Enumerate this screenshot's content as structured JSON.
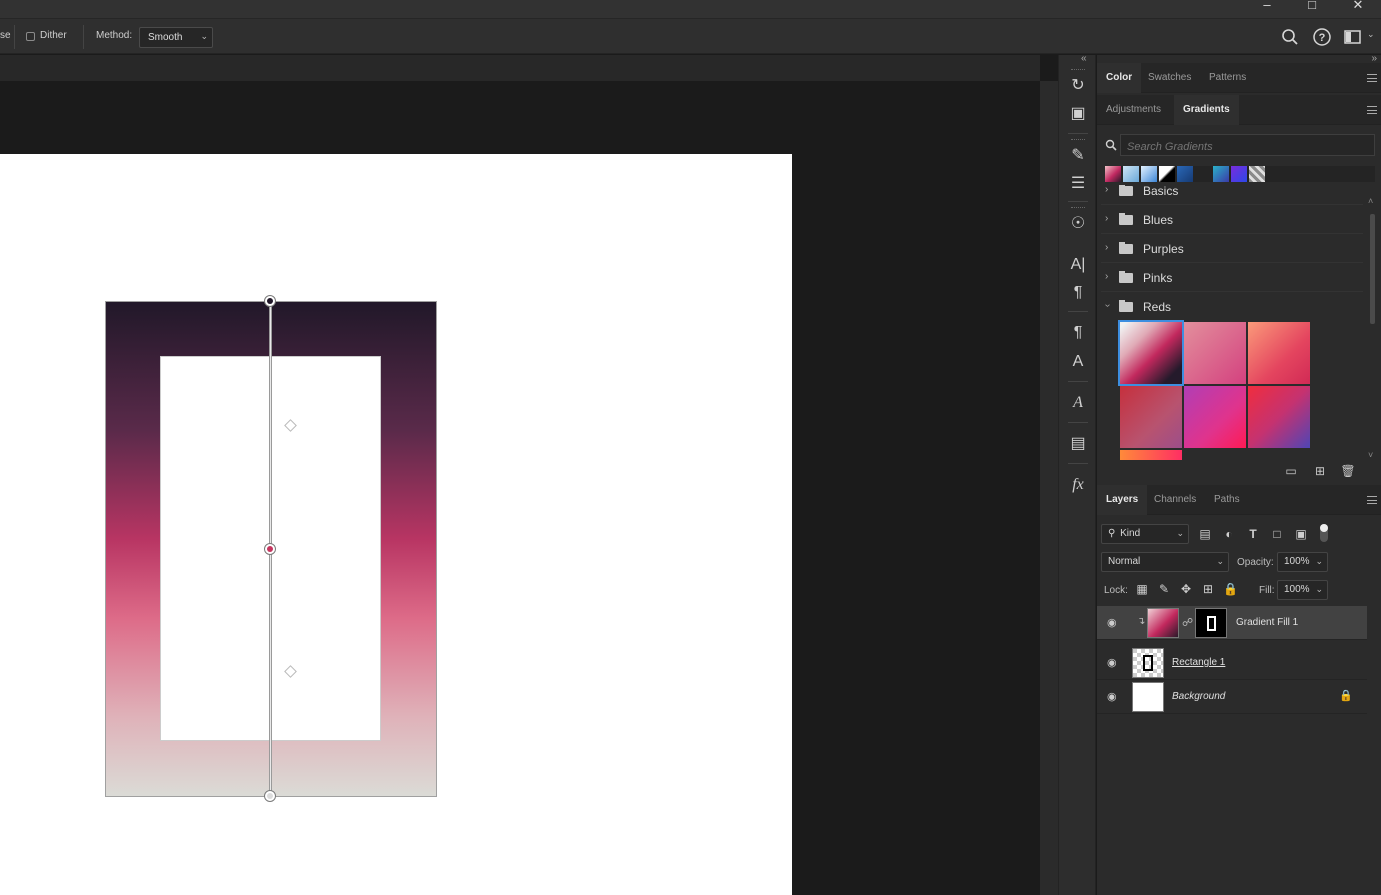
{
  "options_bar": {
    "left_partial_label": "se",
    "dither_label": "Dither",
    "method_label": "Method:",
    "method_value": "Smooth"
  },
  "color_panel": {
    "tabs": [
      {
        "label": "Color",
        "active": true
      },
      {
        "label": "Swatches",
        "active": false
      },
      {
        "label": "Patterns",
        "active": false
      }
    ]
  },
  "gradients_panel": {
    "tabs": [
      {
        "label": "Adjustments",
        "active": false
      },
      {
        "label": "Gradients",
        "active": true
      }
    ],
    "search_placeholder": "Search Gradients",
    "partial_folder": "Basics",
    "folders": [
      {
        "name": "Blues",
        "expanded": false
      },
      {
        "name": "Purples",
        "expanded": false
      },
      {
        "name": "Pinks",
        "expanded": false
      },
      {
        "name": "Reds",
        "expanded": true
      }
    ]
  },
  "layers_panel": {
    "tabs": [
      {
        "label": "Layers",
        "active": true
      },
      {
        "label": "Channels",
        "active": false
      },
      {
        "label": "Paths",
        "active": false
      }
    ],
    "filter_kind": "Kind",
    "blend_mode": "Normal",
    "opacity_label": "Opacity:",
    "opacity_value": "100%",
    "lock_label": "Lock:",
    "fill_label": "Fill:",
    "fill_value": "100%",
    "layers": [
      {
        "name": "Gradient Fill 1",
        "selected": true
      },
      {
        "name": "Rectangle 1",
        "selected": false
      },
      {
        "name": "Background",
        "selected": false,
        "locked": true
      }
    ]
  },
  "colors": {
    "gradient_top": "#211829",
    "gradient_mid": "#b83563",
    "gradient_bottom": "#dbdbd6",
    "selected_tile_border": "#3d8ee0"
  }
}
